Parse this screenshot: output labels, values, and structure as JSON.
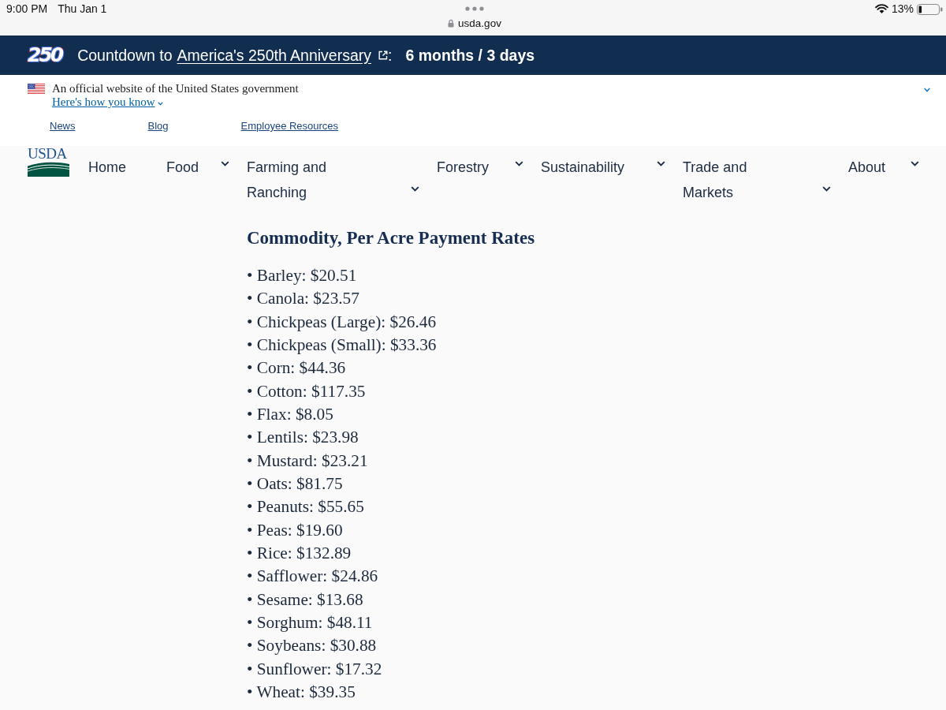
{
  "status_bar": {
    "time": "9:00 PM",
    "date": "Thu Jan 1",
    "address": "usda.gov",
    "battery": "13%"
  },
  "countdown_banner": {
    "logo": "250",
    "prefix": "Countdown to",
    "link": "America's 250th Anniversary",
    "separator": ":",
    "countdown": "6 months / 3 days"
  },
  "gov_banner": {
    "text": "An official website of the United States government",
    "link": "Here's how you know",
    "expanded": false
  },
  "utility_links": [
    "News",
    "Blog",
    "Employee Resources"
  ],
  "header": {
    "logo": "USDA",
    "nav": [
      {
        "label": "Home",
        "kind": "link"
      },
      {
        "label": "Food",
        "kind": "menu",
        "expanded": false
      },
      {
        "label": "Farming and Ranching",
        "kind": "menu",
        "expanded": false
      },
      {
        "label": "Forestry",
        "kind": "menu",
        "expanded": false
      },
      {
        "label": "Sustainability",
        "kind": "menu",
        "expanded": false
      },
      {
        "label": "Trade and Markets",
        "kind": "menu",
        "expanded": false
      },
      {
        "label": "About",
        "kind": "menu",
        "expanded": false
      }
    ]
  },
  "content": {
    "heading": "Commodity, Per Acre Payment Rates",
    "items": [
      "• Barley: $20.51",
      "• Canola: $23.57",
      "• Chickpeas (Large): $26.46",
      "• Chickpeas (Small): $33.36",
      "• Corn: $44.36",
      "• Cotton: $117.35",
      "• Flax: $8.05",
      "• Lentils: $23.98",
      "• Mustard: $23.21",
      "• Oats: $81.75",
      "• Peanuts: $55.65",
      "• Peas: $19.60",
      "• Rice: $132.89",
      "• Safflower: $24.86",
      "• Sesame: $13.68",
      "• Sorghum: $48.11",
      "• Soybeans: $30.88",
      "• Sunflower: $17.32",
      "• Wheat: $39.35"
    ]
  }
}
